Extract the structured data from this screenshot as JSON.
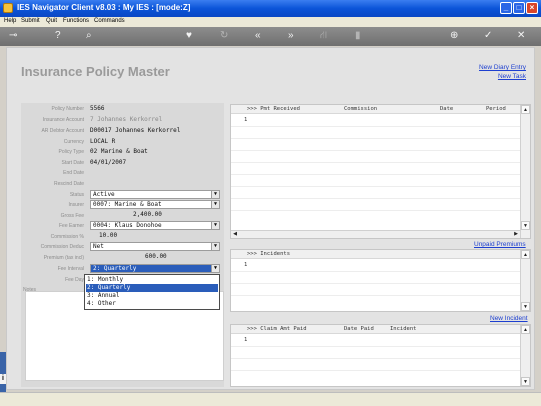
{
  "window": {
    "title": "IES Navigator Client v8.03 : My IES :      [mode:Z]"
  },
  "menu": [
    "Help",
    "Submit",
    "Quit",
    "Functions",
    "Commands"
  ],
  "toolbar": {
    "icons": [
      "key-icon",
      "help-icon",
      "search-icon",
      "heart-icon",
      "refresh-icon",
      "rewind-icon",
      "fast-forward-icon",
      "tree-icon",
      "document-icon",
      "globe-icon",
      "check-icon",
      "close-icon"
    ],
    "glyphs": [
      "⊸",
      "?",
      "⌕",
      "♥",
      "↻",
      "«",
      "»",
      "⛙",
      "▮",
      "⊕",
      "✓",
      "✕"
    ]
  },
  "page": {
    "title": "Insurance Policy Master",
    "links": {
      "new_diary": "New Diary Entry",
      "new_task": "New Task"
    }
  },
  "form": {
    "policy_number": {
      "label": "Policy Number",
      "value": "5566"
    },
    "insurance_account": {
      "label": "Insurance Account",
      "value": "7 Johannes Kerkorrel"
    },
    "ar_debtor_account": {
      "label": "AR Debtor Account",
      "value": "D00017 Johannes Kerkorrel"
    },
    "currency": {
      "label": "Currency",
      "value": "LOCAL R"
    },
    "policy_type": {
      "label": "Policy Type",
      "value": "02 Marine & Boat"
    },
    "start_date": {
      "label": "Start Date",
      "value": "04/01/2007"
    },
    "end_date": {
      "label": "End Date",
      "value": ""
    },
    "rescind_date": {
      "label": "Rescind Date",
      "value": ""
    },
    "status": {
      "label": "Status",
      "value": "Active"
    },
    "insurer": {
      "label": "Insurer",
      "value": "0007: Marine & Boat"
    },
    "gross_fee": {
      "label": "Gross Fee",
      "value": "2,400.00"
    },
    "fee_earner": {
      "label": "Fee Earner",
      "value": "0004: Klaus Donohoe"
    },
    "commission_pct": {
      "label": "Commission %",
      "value": "10.00"
    },
    "commission_deduct": {
      "label": "Commission Deduc",
      "value": "Net"
    },
    "premium": {
      "label": "Premium (tax incl)",
      "value": "600.00"
    },
    "fee_interval": {
      "label": "Fee Interval",
      "value": "2: Quarterly"
    },
    "fee_day": {
      "label": "Fee Day"
    },
    "notes": {
      "label": "Notes"
    },
    "interval_options": [
      "1: Monthly",
      "2: Quarterly",
      "3: Annual",
      "4: Other"
    ]
  },
  "grids": {
    "receipts": {
      "columns": [
        ">>> Pmt Received",
        "Commission",
        "Date",
        "Period"
      ],
      "rows": [
        "1"
      ],
      "link": "Unpaid Premiums"
    },
    "incidents": {
      "columns": [
        ">>> Incidents"
      ],
      "rows": [
        "1"
      ],
      "link": "New Incident"
    },
    "claims": {
      "columns": [
        ">>> Claim Amt Paid",
        "Date Paid",
        "Incident"
      ],
      "rows": [
        "1"
      ]
    }
  },
  "scroll": {
    "up": "▲",
    "down": "▼",
    "left": "◀",
    "right": "▶",
    "dropdown": "▼"
  },
  "colors": {
    "title_bar": "#0b54d8",
    "link": "#1d3fd0",
    "selection": "#2a5dba"
  }
}
